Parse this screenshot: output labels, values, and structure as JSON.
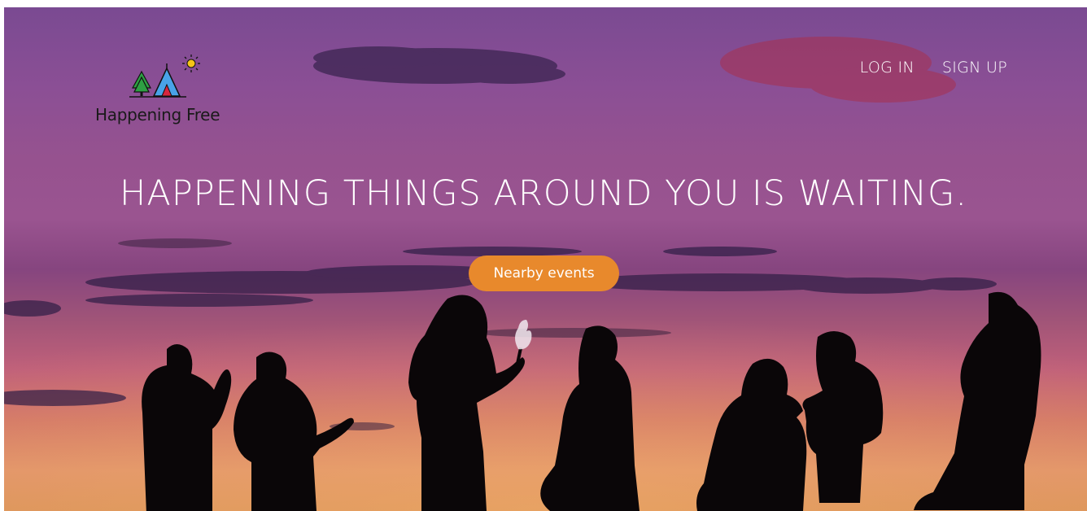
{
  "brand": {
    "name": "Happening Free",
    "logo_icons": [
      "tree-icon",
      "tent-icon",
      "sun-icon"
    ]
  },
  "nav": {
    "login_label": "LOG IN",
    "signup_label": "SIGN UP"
  },
  "hero": {
    "headline": "HAPPENING THINGS AROUND YOU IS WAITING.",
    "cta_label": "Nearby events",
    "background_description_colors": {
      "sky_top": "#7a4a92",
      "sky_bottom": "#d9915a",
      "cta": "#e8892c"
    }
  }
}
